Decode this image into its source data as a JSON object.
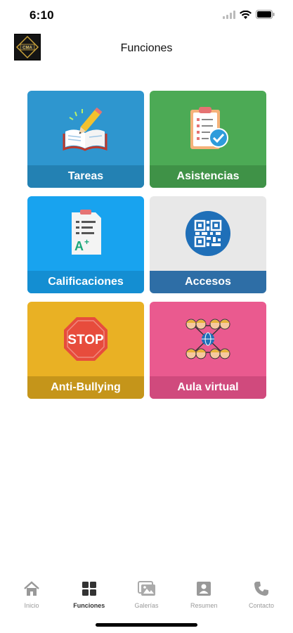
{
  "status": {
    "time": "6:10"
  },
  "header": {
    "title": "Funciones",
    "logo_text": "CMA"
  },
  "tiles": [
    {
      "label": "Tareas",
      "icon": "book-pencil-icon",
      "bg": "#2e96cf",
      "band": "#2381b3"
    },
    {
      "label": "Asistencias",
      "icon": "clipboard-check-icon",
      "bg": "#4caa55",
      "band": "#3f9247"
    },
    {
      "label": "Calificaciones",
      "icon": "grade-sheet-icon",
      "bg": "#18a3ef",
      "band": "#148ed2"
    },
    {
      "label": "Accesos",
      "icon": "qr-code-icon",
      "bg": "#e8e8e8",
      "band": "#2e6ea6"
    },
    {
      "label": "Anti-Bullying",
      "icon": "stop-sign-icon",
      "bg": "#e9b124",
      "band": "#c5951a"
    },
    {
      "label": "Aula virtual",
      "icon": "network-people-icon",
      "bg": "#ea5a8f",
      "band": "#d04a7d"
    }
  ],
  "tabs": [
    {
      "label": "Inicio",
      "icon": "home-icon",
      "active": false
    },
    {
      "label": "Funciones",
      "icon": "grid-icon",
      "active": true
    },
    {
      "label": "Galerías",
      "icon": "gallery-icon",
      "active": false
    },
    {
      "label": "Resumen",
      "icon": "profile-card-icon",
      "active": false
    },
    {
      "label": "Contacto",
      "icon": "phone-icon",
      "active": false
    }
  ]
}
